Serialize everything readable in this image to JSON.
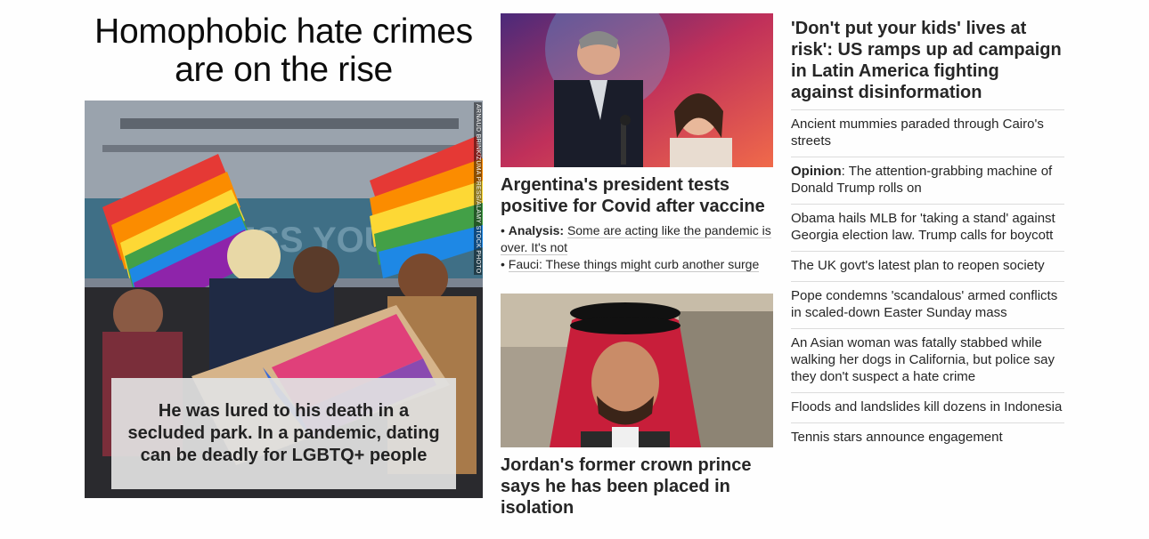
{
  "hero": {
    "title": "Homophobic hate crimes are on the rise",
    "image_alt": "People embracing at a rally with pride flags",
    "image_credit": "ARNAUD BRINK/ZUMA PRESS/ALAMY STOCK PHOTO",
    "caption": "He was lured to his death in a secluded park. In a pandemic, dating can be deadly for LGBTQ+ people"
  },
  "card1": {
    "image_alt": "Argentina's president speaking into a microphone",
    "title": "Argentina's president tests positive for Covid after vaccine",
    "links": [
      {
        "prefix": "Analysis:",
        "text": "Some are acting like the pandemic is over. It's not"
      },
      {
        "prefix": "",
        "text": "Fauci: These things might curb another surge"
      }
    ]
  },
  "card2": {
    "image_alt": "Jordan's former crown prince wearing a red keffiyeh",
    "title": "Jordan's former crown prince says he has been placed in isolation"
  },
  "col3": {
    "lead": "'Don't put your kids' lives at risk': US ramps up ad campaign in Latin America fighting against disinformation",
    "headlines": [
      {
        "prefix": "",
        "text": "Ancient mummies paraded through Cairo's streets"
      },
      {
        "prefix": "Opinion",
        "text": ": The attention-grabbing machine of Donald Trump rolls on"
      },
      {
        "prefix": "",
        "text": "Obama hails MLB for 'taking a stand' against Georgia election law. Trump calls for boycott"
      },
      {
        "prefix": "",
        "text": "The UK govt's latest plan to reopen society"
      },
      {
        "prefix": "",
        "text": "Pope condemns 'scandalous' armed conflicts in scaled-down Easter Sunday mass"
      },
      {
        "prefix": "",
        "text": "An Asian woman was fatally stabbed while walking her dogs in California, but police say they don't suspect a hate crime"
      },
      {
        "prefix": "",
        "text": "Floods and landslides kill dozens in Indonesia"
      },
      {
        "prefix": "",
        "text": "Tennis stars announce engagement"
      }
    ]
  }
}
